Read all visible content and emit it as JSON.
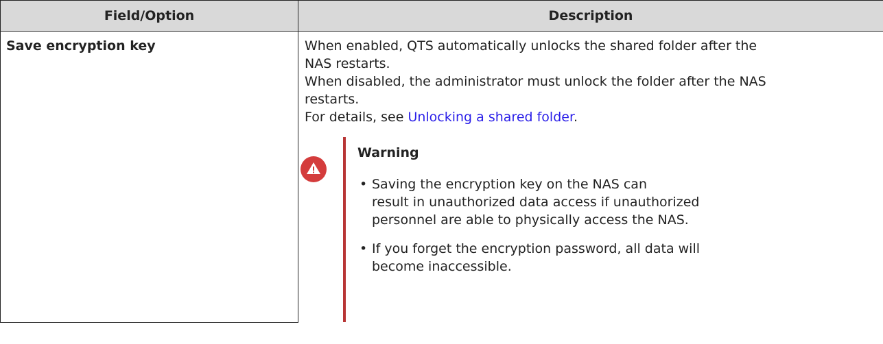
{
  "table": {
    "headers": [
      "Field/Option",
      "Description"
    ],
    "rows": [
      {
        "field": "Save encryption key",
        "description": {
          "line1": "When enabled, QTS automatically unlocks the shared folder after the",
          "line2": "NAS restarts.",
          "line3": "When disabled, the administrator must unlock the folder after the NAS",
          "line4": "restarts.",
          "details_prefix": "For details, see ",
          "details_link": "Unlocking a shared folder",
          "details_suffix": "."
        },
        "warning": {
          "icon": "warning-triangle-icon",
          "title": "Warning",
          "items": [
            {
              "line1": "Saving the encryption key on the NAS can",
              "line2": "result in unauthorized data access if unauthorized",
              "line3": "personnel are able to physically access the NAS."
            },
            {
              "line1": "If you forget the encryption password, all data will",
              "line2": "become inaccessible."
            }
          ]
        }
      }
    ]
  },
  "colors": {
    "header_bg": "#d9d9d9",
    "link": "#2a1ee8",
    "warning_icon": "#d43c3c",
    "warning_bar": "#b83535"
  }
}
